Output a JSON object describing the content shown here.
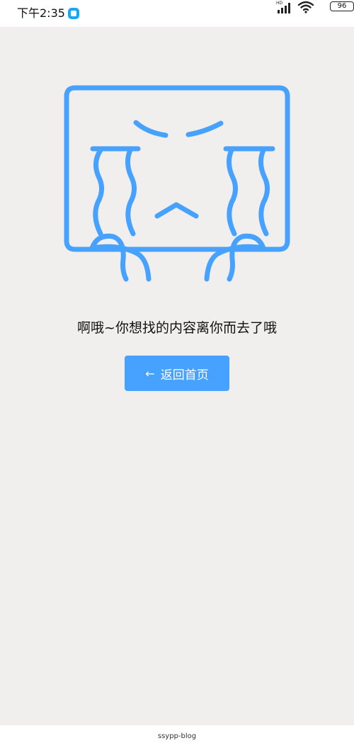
{
  "status_bar": {
    "time": "下午2:35",
    "network_label": "HD",
    "battery_level": "96"
  },
  "illustration": {
    "icon": "crying-face-illustration",
    "color": "#47a2ff"
  },
  "error": {
    "message": "啊哦~你想找的内容离你而去了哦"
  },
  "actions": {
    "home_label": "返回首页",
    "home_icon": "arrow-left-icon"
  },
  "footer": {
    "text": "ssypp-blog"
  },
  "colors": {
    "background": "#f1eeee",
    "accent": "#47a2ff"
  }
}
